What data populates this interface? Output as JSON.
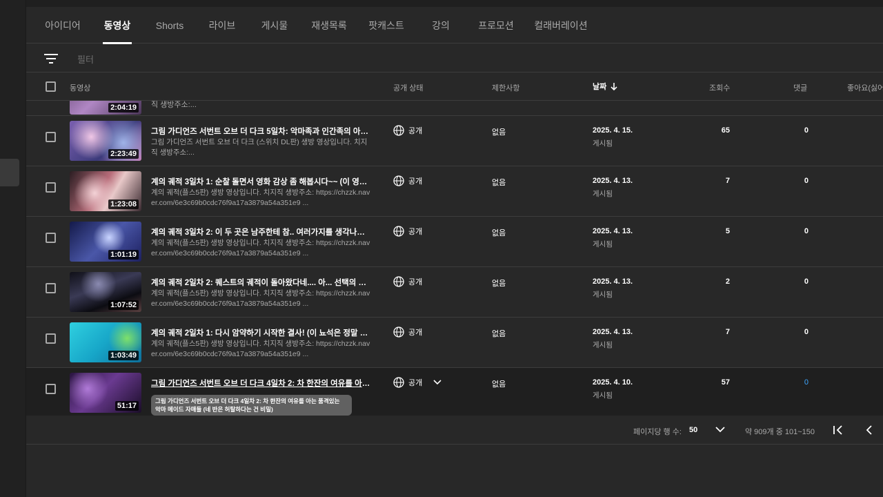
{
  "tabs": [
    {
      "label": "아이디어"
    },
    {
      "label": "동영상"
    },
    {
      "label": "Shorts"
    },
    {
      "label": "라이브"
    },
    {
      "label": "게시물"
    },
    {
      "label": "재생목록"
    },
    {
      "label": "팟캐스트"
    },
    {
      "label": "강의"
    },
    {
      "label": "프로모션"
    },
    {
      "label": "컬래버레이션"
    }
  ],
  "active_tab": "동영상",
  "filter": {
    "placeholder": "필터",
    "icon": "filter-icon"
  },
  "columns": {
    "video": "동영상",
    "visibility": "공개 상태",
    "restrictions": "제한사항",
    "date": "날짜",
    "views": "조회수",
    "comments": "댓글",
    "likes": "좋아요(싫어"
  },
  "sort": {
    "column": "date",
    "direction": "descending",
    "icon": "arrow-down-icon"
  },
  "partial_row": {
    "duration": "2:04:19",
    "desc": "직 생방주소:..."
  },
  "rows": [
    {
      "title": "그림 가디언즈 서번트 오브 더 다크 5일차: 악마족과 인간족의 아름...",
      "desc": "그림 가디언즈 서번트 오브 더 다크 (스위치 DL판) 생방 영상입니다. 치지직 생방주소:...",
      "duration": "2:23:49",
      "visibility": "공개",
      "restrictions": "없음",
      "date": "2025. 4. 15.",
      "status": "게시됨",
      "views": "65",
      "comments": "0"
    },
    {
      "title": "계의 궤적 3일차 1: 순찰 돌면서 영화 감상 좀 해봅시다~~ (이 영화...",
      "desc": "계의 궤적(플스5판) 생방 영상입니다. 치지직 생방주소: https://chzzk.naver.com/6e3c69b0cdc76f9a17a3879a54a351e9 ...",
      "duration": "1:23:08",
      "visibility": "공개",
      "restrictions": "없음",
      "date": "2025. 4. 13.",
      "status": "게시됨",
      "views": "7",
      "comments": "0"
    },
    {
      "title": "계의 궤적 3일차 2: 이 두 곳은 남주한테 참.. 여러가지를 생각나게 ...",
      "desc": "계의 궤적(플스5판) 생방 영상입니다. 치지직 생방주소: https://chzzk.naver.com/6e3c69b0cdc76f9a17a3879a54a351e9 ...",
      "duration": "1:01:19",
      "visibility": "공개",
      "restrictions": "없음",
      "date": "2025. 4. 13.",
      "status": "게시됨",
      "views": "5",
      "comments": "0"
    },
    {
      "title": "계의 궤적 2일차 2: 퀘스트의 궤적이 돌아왔다네.... 아... 선택의 고...",
      "desc": "계의 궤적(플스5판) 생방 영상입니다. 치지직 생방주소: https://chzzk.naver.com/6e3c69b0cdc76f9a17a3879a54a351e9 ...",
      "duration": "1:07:52",
      "visibility": "공개",
      "restrictions": "없음",
      "date": "2025. 4. 13.",
      "status": "게시됨",
      "views": "2",
      "comments": "0"
    },
    {
      "title": "계의 궤적 2일차 1: 다시 암약하기 시작한 결사! (이 뇨석은 정말 안 ...",
      "desc": "계의 궤적(플스5판) 생방 영상입니다. 치지직 생방주소: https://chzzk.naver.com/6e3c69b0cdc76f9a17a3879a54a351e9 ...",
      "duration": "1:03:49",
      "visibility": "공개",
      "restrictions": "없음",
      "date": "2025. 4. 13.",
      "status": "게시됨",
      "views": "7",
      "comments": "0"
    },
    {
      "title": "그림 가디언즈 서번트 오브 더 다크 4일차 2: 차 한잔의 여유를 아는 ...",
      "desc": "",
      "duration": "51:17",
      "visibility": "공개",
      "restrictions": "없음",
      "date": "2025. 4. 10.",
      "status": "게시됨",
      "views": "57",
      "comments": "0"
    }
  ],
  "tooltip": {
    "line1": "그림 가디언즈 서번트 오브 더 다크 4일차 2: 차 한잔의 여유를 아는 품격있는",
    "line2": "악마 메이드 자매들 (네 반은 허탈하다는 건 비밀)"
  },
  "pagination": {
    "rows_per_page_label": "페이지당 행 수:",
    "rows_per_page": "50",
    "range": "약 909개 중 101~150"
  },
  "colors": {
    "background": "#282828",
    "divider": "#3d3d3d",
    "link": "#3ea6ff",
    "muted": "#aaaaaa"
  }
}
